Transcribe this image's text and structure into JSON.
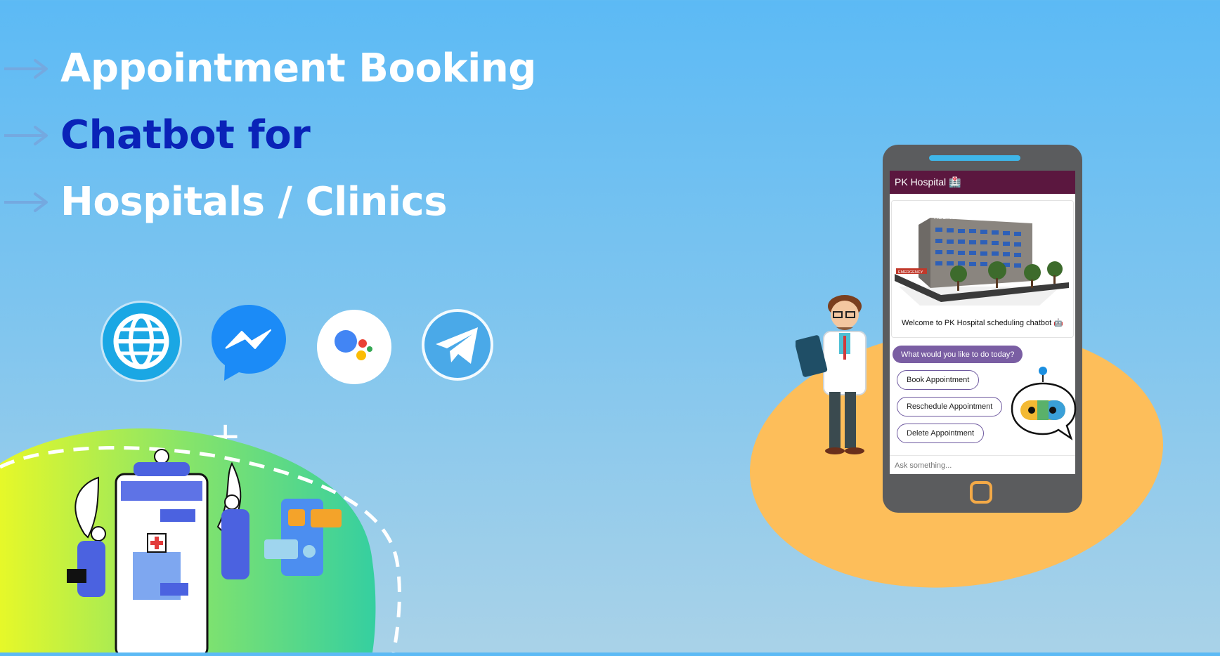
{
  "headline": {
    "line1": "Appointment Booking",
    "line2": "Chatbot for",
    "line3": "Hospitals / Clinics"
  },
  "channels": [
    {
      "icon": "globe-icon"
    },
    {
      "icon": "messenger-icon"
    },
    {
      "icon": "google-assistant-icon"
    },
    {
      "icon": "telegram-icon"
    }
  ],
  "phone": {
    "header_title": "PK Hospital 🏥",
    "hospital_sign": "HOSPITAL",
    "emergency_sign": "EMERGENCY",
    "welcome": "Welcome to PK Hospital scheduling chatbot 🤖",
    "question": "What would you like to do today?",
    "options": [
      "Book Appointment",
      "Reschedule Appointment",
      "Delete Appointment"
    ],
    "input_placeholder": "Ask something..."
  },
  "colors": {
    "headline_white": "#ffffff",
    "headline_blue": "#0a23b8",
    "chat_header": "#5b173f",
    "question_bubble": "#7a5ea3",
    "orange_blob": "#fdbe5a",
    "phone_body": "#5b5c5e"
  }
}
